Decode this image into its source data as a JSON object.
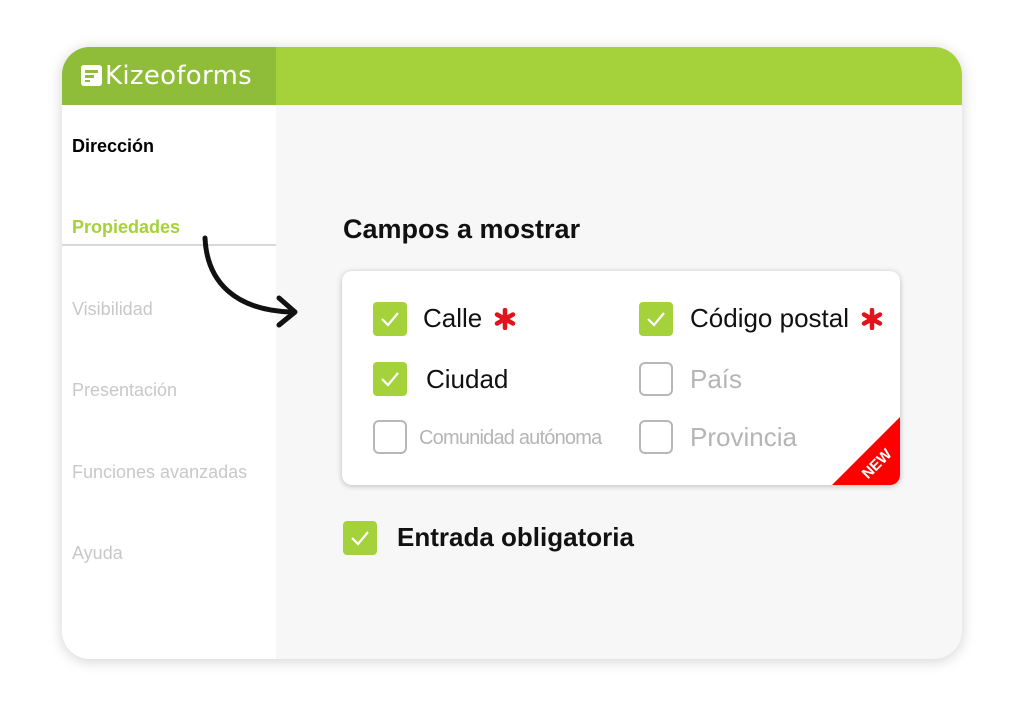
{
  "app": {
    "logo_text": "Kizeoforms"
  },
  "sidebar": {
    "items": [
      {
        "label": "Dirección"
      },
      {
        "label": "Propiedades"
      },
      {
        "label": "Visibilidad"
      },
      {
        "label": "Presentación"
      },
      {
        "label": "Funciones avanzadas"
      },
      {
        "label": "Ayuda"
      }
    ]
  },
  "fields_section": {
    "title": "Campos a mostrar",
    "fields": [
      {
        "label": "Calle",
        "checked": true,
        "required": true
      },
      {
        "label": "Código postal",
        "checked": true,
        "required": true
      },
      {
        "label": "Ciudad",
        "checked": true,
        "required": false
      },
      {
        "label": "País",
        "checked": false,
        "required": false
      },
      {
        "label": "Comunidad autónoma",
        "checked": false,
        "required": false
      },
      {
        "label": "Provincia",
        "checked": false,
        "required": false
      }
    ],
    "badge": "NEW"
  },
  "required_entry": {
    "label": "Entrada obligatoria",
    "checked": true
  },
  "colors": {
    "accent": "#a5d23a",
    "logo_bg": "#8fbd3a",
    "required": "#e0141d",
    "badge": "#ff0000"
  }
}
